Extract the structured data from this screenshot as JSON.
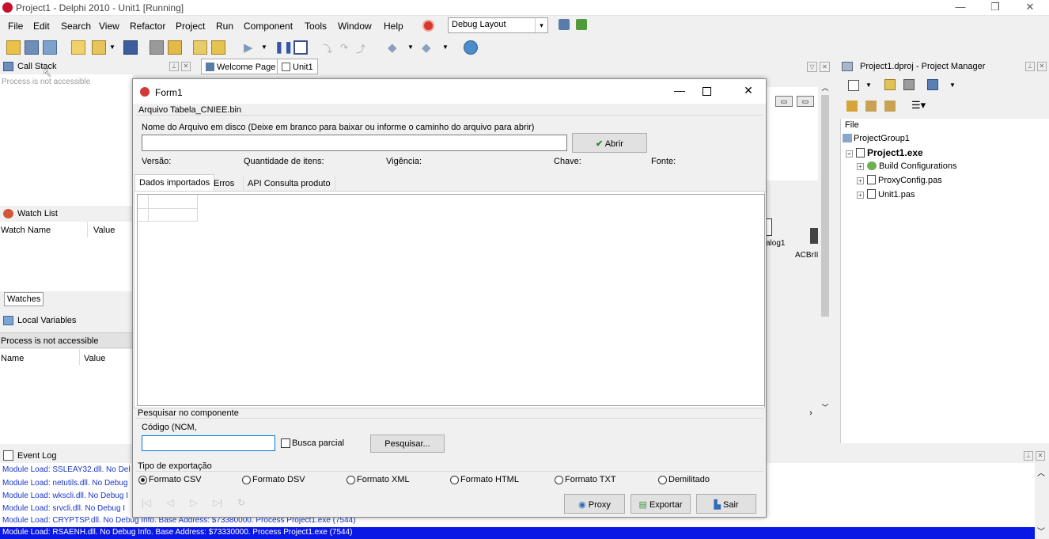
{
  "ide": {
    "title": "Project1 - Delphi 2010 - Unit1 [Running]",
    "window_controls": {
      "minimize": "—",
      "restore": "❐",
      "close": "✕"
    },
    "menu": [
      {
        "label": "File"
      },
      {
        "label": "Edit"
      },
      {
        "label": "Search"
      },
      {
        "label": "View"
      },
      {
        "label": "Refactor"
      },
      {
        "label": "Project"
      },
      {
        "label": "Run"
      },
      {
        "label": "Component"
      },
      {
        "label": "Tools"
      },
      {
        "label": "Window"
      },
      {
        "label": "Help"
      }
    ],
    "layout_combo": "Debug Layout",
    "toolbar_icons": [
      "new-form-icon",
      "new-unit-icon",
      "open-project-icon",
      "new-item-icon",
      "open-icon",
      "save-icon",
      "save-all-icon",
      "open-file-icon",
      "add-to-project-icon",
      "remove-from-project-icon",
      "run-icon",
      "pause-icon",
      "stop-icon",
      "trace-into-icon",
      "step-over-icon",
      "run-to-return-icon",
      "back-icon",
      "forward-icon",
      "help-icon"
    ],
    "colors": {
      "accent": "#0000ff",
      "log_text": "#1a35c8",
      "form_icon": "#d23a3a"
    }
  },
  "call_stack": {
    "title": "Call Stack",
    "status": "Process is not accessible"
  },
  "watch_list": {
    "title": "Watch List",
    "col_name": "Watch Name",
    "col_value": "Value",
    "tab": "Watches"
  },
  "local_vars": {
    "title": "Local Variables",
    "status": "Process is not accessible",
    "col_name": "Name",
    "col_value": "Value"
  },
  "editor": {
    "tabs": [
      {
        "label": "Welcome Page"
      },
      {
        "label": "Unit1"
      }
    ],
    "component_labels": [
      "alog1",
      "ACBrII"
    ]
  },
  "project_manager": {
    "title": "Project1.dproj - Project Manager",
    "col_file": "File",
    "tree": {
      "group": "ProjectGroup1",
      "project": "Project1.exe",
      "items": [
        "Build Configurations",
        "ProxyConfig.pas",
        "Unit1.pas"
      ]
    }
  },
  "event_log": {
    "title": "Event Log",
    "lines": [
      "Module Load: SSLEAY32.dll. No Del",
      "Module Load: netutils.dll. No Debug",
      "Module Load: wkscli.dll. No Debug I",
      "Module Load: srvcli.dll. No Debug I",
      "Module Load: CRYPTSP.dll. No Debug Info. Base Address: $73380000. Process Project1.exe (7544)",
      "Module Load: RSAENH.dll. No Debug Info. Base Address: $73330000. Process Project1.exe (7544)"
    ]
  },
  "form1": {
    "title": "Form1",
    "group_title": "Arquivo Tabela_CNIEE.bin",
    "file_label": "Nome do Arquivo em disco (Deixe em branco para baixar ou informe o caminho do arquivo para abrir)",
    "file_value": "",
    "open_button": "Abrir",
    "info": {
      "version": "Versão:",
      "count": "Quantidade de itens:",
      "validity": "Vigência:",
      "key": "Chave:",
      "source": "Fonte:"
    },
    "tabs": [
      {
        "label": "Dados importados"
      },
      {
        "label": "Erros"
      },
      {
        "label": "API Consulta produto"
      }
    ],
    "search": {
      "group_title": "Pesquisar no componente",
      "label": "Código (NCM,",
      "value": "",
      "partial_label": "Busca parcial",
      "partial_checked": false,
      "button": "Pesquisar..."
    },
    "export": {
      "group_title": "Tipo de exportação",
      "options": [
        "Formato CSV",
        "Formato DSV",
        "Formato XML",
        "Formato HTML",
        "Formato TXT",
        "Demilitado"
      ],
      "selected": "Formato CSV"
    },
    "nav_glyphs": [
      "|◁",
      "◁",
      "▷",
      "▷|",
      "↻"
    ],
    "buttons": {
      "proxy": "Proxy",
      "export": "Exportar",
      "exit": "Sair"
    }
  }
}
